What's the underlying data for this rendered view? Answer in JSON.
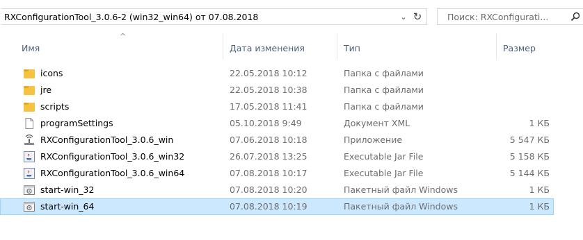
{
  "address": {
    "path": "RXConfigurationTool_3.0.6-2 (win32_win64) от 07.08.2018",
    "dropdown_glyph": "⌄",
    "refresh_glyph": "↻"
  },
  "search": {
    "placeholder": "Поиск: RXConfigurati..."
  },
  "columns": {
    "name": "Имя",
    "date": "Дата изменения",
    "type": "Тип",
    "size": "Размер"
  },
  "files": [
    {
      "name": "icons",
      "date": "22.05.2018 10:12",
      "type": "Папка с файлами",
      "size": "",
      "icon": "folder-icon"
    },
    {
      "name": "jre",
      "date": "22.05.2018 10:38",
      "type": "Папка с файлами",
      "size": "",
      "icon": "folder-icon"
    },
    {
      "name": "scripts",
      "date": "17.05.2018 11:41",
      "type": "Папка с файлами",
      "size": "",
      "icon": "folder-icon"
    },
    {
      "name": "programSettings",
      "date": "05.10.2018 9:49",
      "type": "Документ XML",
      "size": "1 КБ",
      "icon": "document-icon"
    },
    {
      "name": "RXConfigurationTool_3.0.6_win",
      "date": "07.06.2018 10:18",
      "type": "Приложение",
      "size": "5 547 КБ",
      "icon": "application-icon"
    },
    {
      "name": "RXConfigurationTool_3.0.6_win32",
      "date": "26.07.2018 13:25",
      "type": "Executable Jar File",
      "size": "5 158 КБ",
      "icon": "java-jar-icon"
    },
    {
      "name": "RXConfigurationTool_3.0.6_win64",
      "date": "07.08.2018 10:17",
      "type": "Executable Jar File",
      "size": "5 144 КБ",
      "icon": "java-jar-icon"
    },
    {
      "name": "start-win_32",
      "date": "07.08.2018 10:20",
      "type": "Пакетный файл Windows",
      "size": "1 КБ",
      "icon": "batch-file-icon"
    },
    {
      "name": "start-win_64",
      "date": "07.08.2018 10:19",
      "type": "Пакетный файл Windows",
      "size": "1 КБ",
      "icon": "batch-file-icon",
      "selected": true
    }
  ],
  "colors": {
    "selection_fill": "#cce8ff",
    "selection_border": "#99d1ff",
    "folder": "#f5c242",
    "header_text": "#4c607a",
    "meta_text": "#6d6d6d"
  }
}
